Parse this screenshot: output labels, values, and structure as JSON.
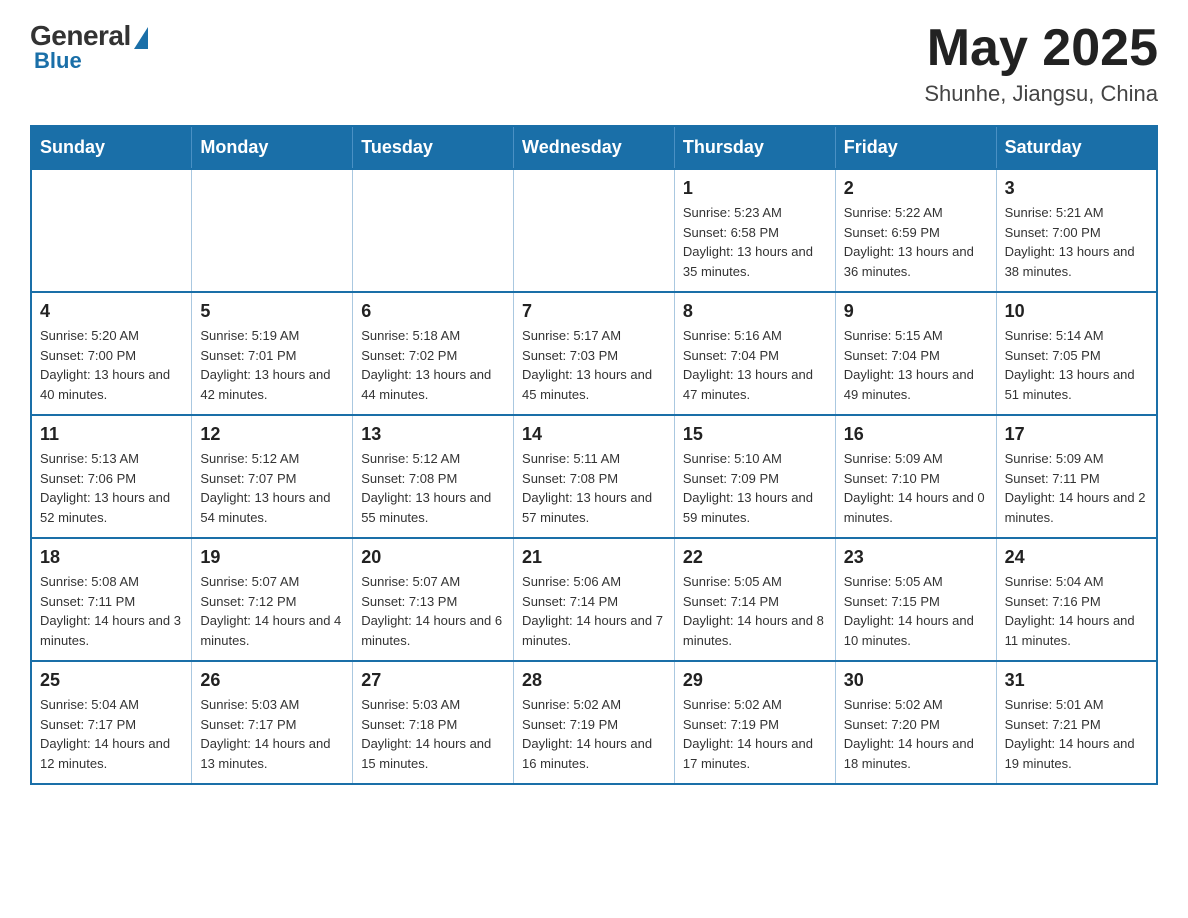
{
  "header": {
    "logo": {
      "general": "General",
      "blue": "Blue"
    },
    "title": "May 2025",
    "location": "Shunhe, Jiangsu, China"
  },
  "weekdays": [
    "Sunday",
    "Monday",
    "Tuesday",
    "Wednesday",
    "Thursday",
    "Friday",
    "Saturday"
  ],
  "weeks": [
    [
      {
        "day": "",
        "info": ""
      },
      {
        "day": "",
        "info": ""
      },
      {
        "day": "",
        "info": ""
      },
      {
        "day": "",
        "info": ""
      },
      {
        "day": "1",
        "info": "Sunrise: 5:23 AM\nSunset: 6:58 PM\nDaylight: 13 hours\nand 35 minutes."
      },
      {
        "day": "2",
        "info": "Sunrise: 5:22 AM\nSunset: 6:59 PM\nDaylight: 13 hours\nand 36 minutes."
      },
      {
        "day": "3",
        "info": "Sunrise: 5:21 AM\nSunset: 7:00 PM\nDaylight: 13 hours\nand 38 minutes."
      }
    ],
    [
      {
        "day": "4",
        "info": "Sunrise: 5:20 AM\nSunset: 7:00 PM\nDaylight: 13 hours\nand 40 minutes."
      },
      {
        "day": "5",
        "info": "Sunrise: 5:19 AM\nSunset: 7:01 PM\nDaylight: 13 hours\nand 42 minutes."
      },
      {
        "day": "6",
        "info": "Sunrise: 5:18 AM\nSunset: 7:02 PM\nDaylight: 13 hours\nand 44 minutes."
      },
      {
        "day": "7",
        "info": "Sunrise: 5:17 AM\nSunset: 7:03 PM\nDaylight: 13 hours\nand 45 minutes."
      },
      {
        "day": "8",
        "info": "Sunrise: 5:16 AM\nSunset: 7:04 PM\nDaylight: 13 hours\nand 47 minutes."
      },
      {
        "day": "9",
        "info": "Sunrise: 5:15 AM\nSunset: 7:04 PM\nDaylight: 13 hours\nand 49 minutes."
      },
      {
        "day": "10",
        "info": "Sunrise: 5:14 AM\nSunset: 7:05 PM\nDaylight: 13 hours\nand 51 minutes."
      }
    ],
    [
      {
        "day": "11",
        "info": "Sunrise: 5:13 AM\nSunset: 7:06 PM\nDaylight: 13 hours\nand 52 minutes."
      },
      {
        "day": "12",
        "info": "Sunrise: 5:12 AM\nSunset: 7:07 PM\nDaylight: 13 hours\nand 54 minutes."
      },
      {
        "day": "13",
        "info": "Sunrise: 5:12 AM\nSunset: 7:08 PM\nDaylight: 13 hours\nand 55 minutes."
      },
      {
        "day": "14",
        "info": "Sunrise: 5:11 AM\nSunset: 7:08 PM\nDaylight: 13 hours\nand 57 minutes."
      },
      {
        "day": "15",
        "info": "Sunrise: 5:10 AM\nSunset: 7:09 PM\nDaylight: 13 hours\nand 59 minutes."
      },
      {
        "day": "16",
        "info": "Sunrise: 5:09 AM\nSunset: 7:10 PM\nDaylight: 14 hours\nand 0 minutes."
      },
      {
        "day": "17",
        "info": "Sunrise: 5:09 AM\nSunset: 7:11 PM\nDaylight: 14 hours\nand 2 minutes."
      }
    ],
    [
      {
        "day": "18",
        "info": "Sunrise: 5:08 AM\nSunset: 7:11 PM\nDaylight: 14 hours\nand 3 minutes."
      },
      {
        "day": "19",
        "info": "Sunrise: 5:07 AM\nSunset: 7:12 PM\nDaylight: 14 hours\nand 4 minutes."
      },
      {
        "day": "20",
        "info": "Sunrise: 5:07 AM\nSunset: 7:13 PM\nDaylight: 14 hours\nand 6 minutes."
      },
      {
        "day": "21",
        "info": "Sunrise: 5:06 AM\nSunset: 7:14 PM\nDaylight: 14 hours\nand 7 minutes."
      },
      {
        "day": "22",
        "info": "Sunrise: 5:05 AM\nSunset: 7:14 PM\nDaylight: 14 hours\nand 8 minutes."
      },
      {
        "day": "23",
        "info": "Sunrise: 5:05 AM\nSunset: 7:15 PM\nDaylight: 14 hours\nand 10 minutes."
      },
      {
        "day": "24",
        "info": "Sunrise: 5:04 AM\nSunset: 7:16 PM\nDaylight: 14 hours\nand 11 minutes."
      }
    ],
    [
      {
        "day": "25",
        "info": "Sunrise: 5:04 AM\nSunset: 7:17 PM\nDaylight: 14 hours\nand 12 minutes."
      },
      {
        "day": "26",
        "info": "Sunrise: 5:03 AM\nSunset: 7:17 PM\nDaylight: 14 hours\nand 13 minutes."
      },
      {
        "day": "27",
        "info": "Sunrise: 5:03 AM\nSunset: 7:18 PM\nDaylight: 14 hours\nand 15 minutes."
      },
      {
        "day": "28",
        "info": "Sunrise: 5:02 AM\nSunset: 7:19 PM\nDaylight: 14 hours\nand 16 minutes."
      },
      {
        "day": "29",
        "info": "Sunrise: 5:02 AM\nSunset: 7:19 PM\nDaylight: 14 hours\nand 17 minutes."
      },
      {
        "day": "30",
        "info": "Sunrise: 5:02 AM\nSunset: 7:20 PM\nDaylight: 14 hours\nand 18 minutes."
      },
      {
        "day": "31",
        "info": "Sunrise: 5:01 AM\nSunset: 7:21 PM\nDaylight: 14 hours\nand 19 minutes."
      }
    ]
  ]
}
